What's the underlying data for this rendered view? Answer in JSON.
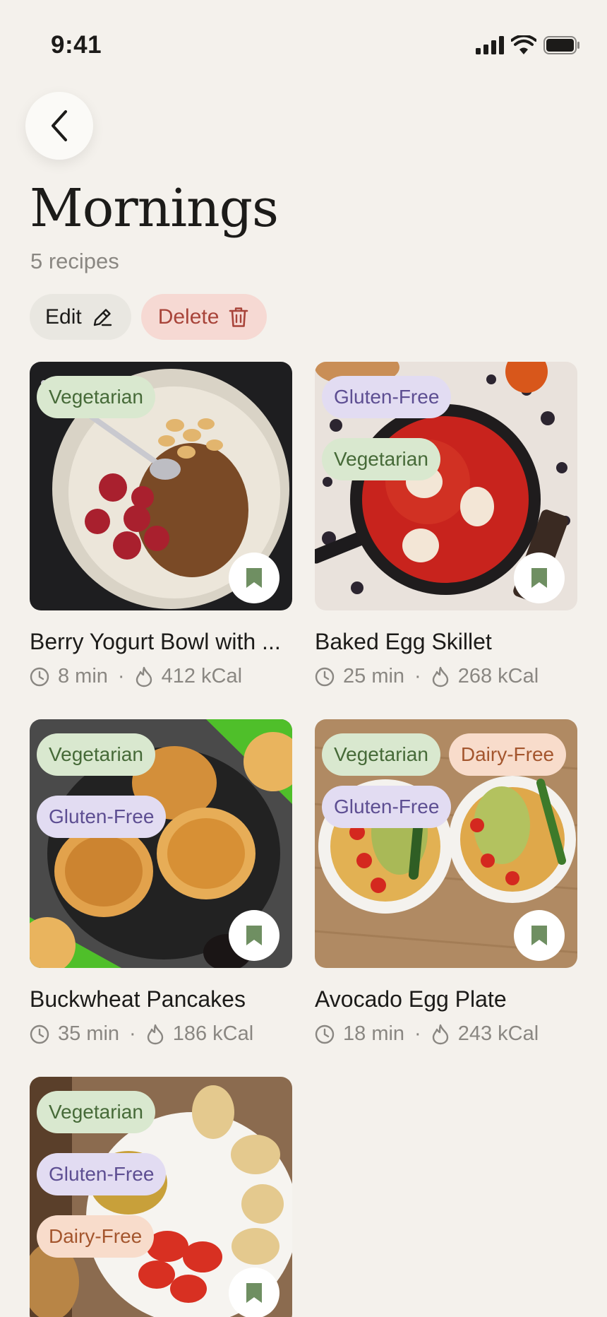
{
  "status_bar": {
    "time": "9:41",
    "icons": [
      "signal-icon",
      "wifi-icon",
      "battery-icon"
    ]
  },
  "header": {
    "back_icon": "chevron-left-icon",
    "title": "Mornings",
    "count": "5 recipes",
    "edit_label": "Edit",
    "delete_label": "Delete"
  },
  "colors": {
    "background": "#f4f1ec",
    "vegetarian_tag": "#d9e8cf",
    "gluten_free_tag": "#e2dcf2",
    "dairy_free_tag": "#f8dccb",
    "delete": "#f6d9d3",
    "bookmark": "#6f8f62"
  },
  "recipes": [
    {
      "title": "Berry Yogurt Bowl with ...",
      "time": "8 min",
      "kcal": "412 kCal",
      "tags": [
        "Vegetarian"
      ]
    },
    {
      "title": "Baked Egg Skillet",
      "time": "25 min",
      "kcal": "268 kCal",
      "tags": [
        "Gluten-Free",
        "Vegetarian"
      ]
    },
    {
      "title": "Buckwheat Pancakes",
      "time": "35 min",
      "kcal": "186 kCal",
      "tags": [
        "Vegetarian",
        "Gluten-Free"
      ]
    },
    {
      "title": "Avocado Egg Plate",
      "time": "18 min",
      "kcal": "243 kCal",
      "tags": [
        "Vegetarian",
        "Dairy-Free",
        "Gluten-Free"
      ]
    },
    {
      "title": "",
      "time": "",
      "kcal": "",
      "tags": [
        "Vegetarian",
        "Gluten-Free",
        "Dairy-Free"
      ]
    }
  ]
}
